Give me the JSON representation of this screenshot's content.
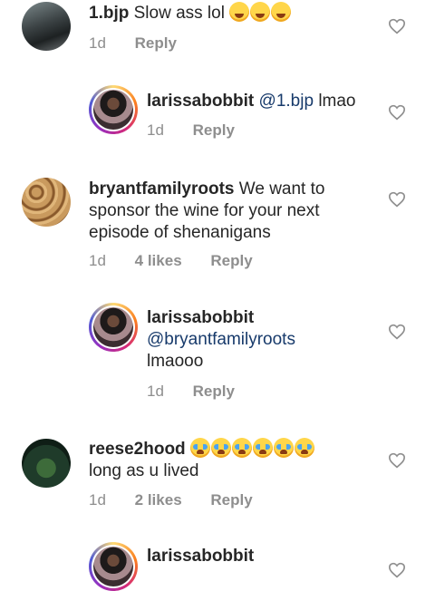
{
  "comments": [
    {
      "username": "1.bjp",
      "text": "Slow ass lol",
      "time": "1d",
      "likes": "",
      "reply": "Reply"
    },
    {
      "username": "larissabobbit",
      "mention": "@1.bjp",
      "text": "lmao",
      "time": "1d",
      "likes": "",
      "reply": "Reply"
    },
    {
      "username": "bryantfamilyroots",
      "text_line1": "We want to",
      "text_line2": "sponsor the wine for your next",
      "text_line3": "episode of shenanigans",
      "time": "1d",
      "likes": "4 likes",
      "reply": "Reply"
    },
    {
      "username": "larissabobbit",
      "mention": "@bryantfamilyroots",
      "text": "lmaooo",
      "time": "1d",
      "likes": "",
      "reply": "Reply"
    },
    {
      "username": "reese2hood",
      "text": "long as u lived",
      "time": "1d",
      "likes": "2 likes",
      "reply": "Reply"
    },
    {
      "username": "larissabobbit"
    }
  ],
  "icons": {
    "like": "heart-outline-icon",
    "laugh": "laughing-tears-emoji",
    "cry": "loudly-crying-emoji"
  },
  "colors": {
    "mention": "#173a6b",
    "meta": "#8e8e8e",
    "text": "#262626"
  }
}
